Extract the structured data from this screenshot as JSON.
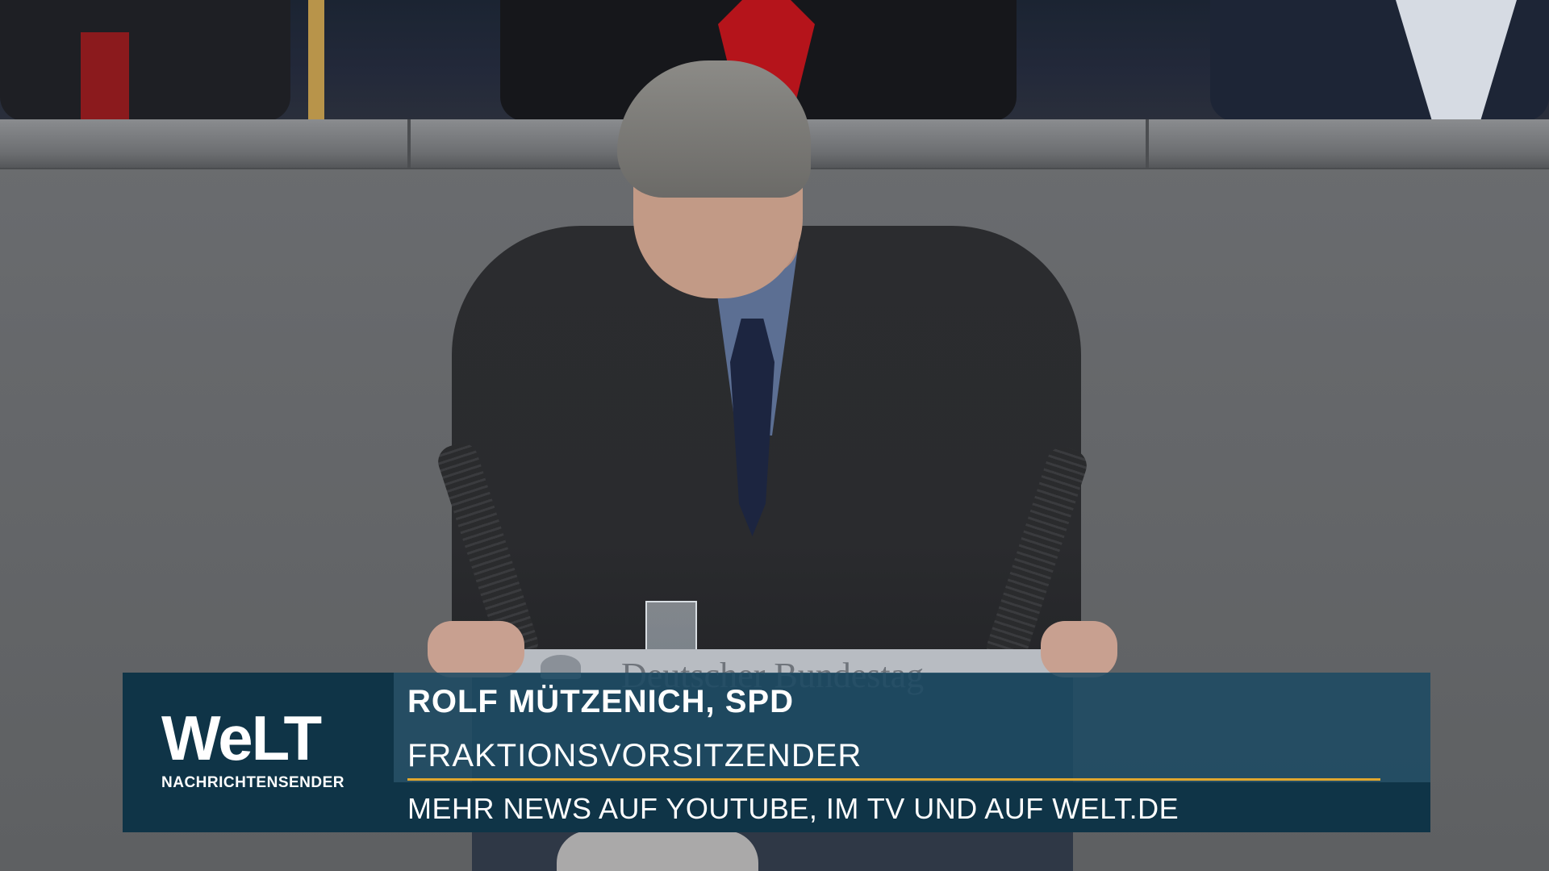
{
  "lower_third": {
    "logo_title": "WeLT",
    "logo_subtitle": "NACHRICHTENSENDER",
    "name": "ROLF MÜTZENICH, SPD",
    "role": "FRAKTIONSVORSITZENDER",
    "ticker": "MEHR NEWS AUF YOUTUBE, IM TV UND AUF WELT.DE",
    "colors": {
      "logo_bg": "#0f3447",
      "name_bg": "#1c4a63",
      "divider": "#e0a72f"
    }
  },
  "scene": {
    "lectern_text": "Deutscher Bundestag"
  }
}
